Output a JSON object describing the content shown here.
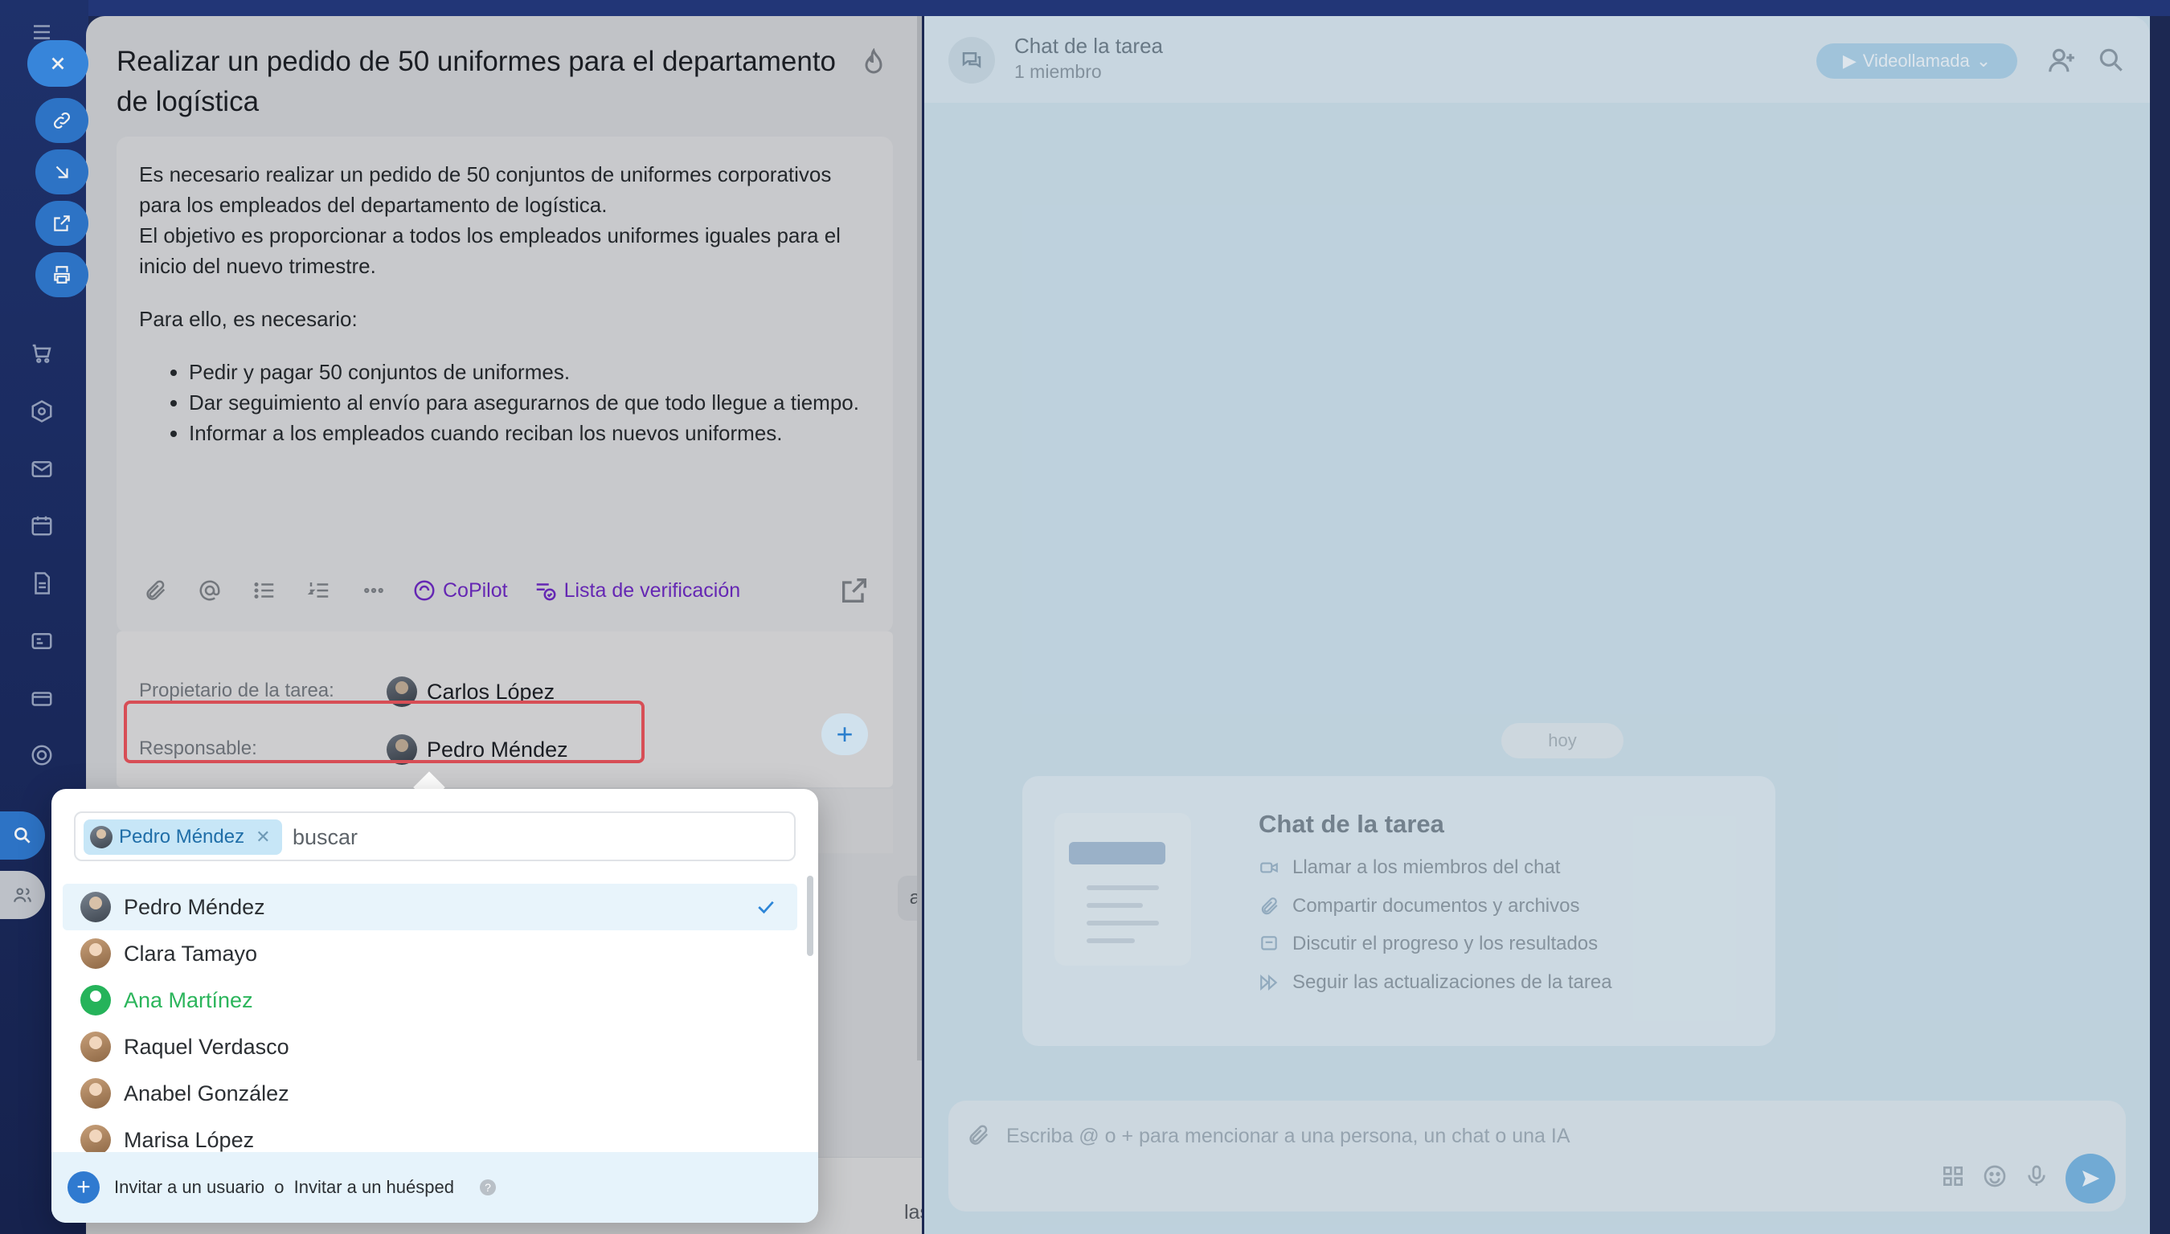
{
  "task": {
    "title": "Realizar un pedido de 50 uniformes para el departamento de logística",
    "description": {
      "para1": "Es necesario realizar un pedido de 50 conjuntos de uniformes corporativos para los empleados del departamento de logística.",
      "para2": "El objetivo es proporcionar a todos los empleados uniformes iguales para el inicio del nuevo trimestre.",
      "para3": "Para ello, es necesario:",
      "bullets": [
        "Pedir y pagar 50 conjuntos de uniformes.",
        "Dar seguimiento al envío para asegurarnos de que todo llegue a tiempo.",
        "Informar a los empleados cuando reciban los nuevos uniformes."
      ]
    },
    "toolbar": {
      "copilot_label": "CoPilot",
      "checklist_label": "Lista de verificación"
    },
    "owner_label": "Propietario de la tarea:",
    "owner_name": "Carlos López",
    "responsible_label": "Responsable:",
    "responsible_name": "Pedro Méndez",
    "partial_button": "ación",
    "bottom_more": "las"
  },
  "chat": {
    "title": "Chat de la tarea",
    "members": "1 miembro",
    "video_button": "Videollamada",
    "day_pill": "hoy",
    "info": {
      "title": "Chat de la tarea",
      "items": [
        "Llamar a los miembros del chat",
        "Compartir documentos y archivos",
        "Discutir el progreso y los resultados",
        "Seguir las actualizaciones de la tarea"
      ]
    },
    "composer_placeholder": "Escriba @ o + para mencionar a una persona, un chat o una IA"
  },
  "picker": {
    "chip_name": "Pedro Méndez",
    "search_placeholder": "buscar",
    "people": [
      {
        "name": "Pedro Méndez",
        "selected": true
      },
      {
        "name": "Clara Tamayo",
        "selected": false
      },
      {
        "name": "Ana Martínez",
        "selected": false
      },
      {
        "name": "Raquel Verdasco",
        "selected": false
      },
      {
        "name": "Anabel González",
        "selected": false
      },
      {
        "name": "Marisa López",
        "selected": false
      }
    ],
    "footer": {
      "invite_user": "Invitar a un usuario",
      "or": "o",
      "invite_guest": "Invitar a un huésped"
    }
  },
  "colors": {
    "accent": "#2f7ad0",
    "highlight_border": "#e4525a",
    "copilot": "#7a2fd8",
    "online_green": "#2bb55b"
  }
}
